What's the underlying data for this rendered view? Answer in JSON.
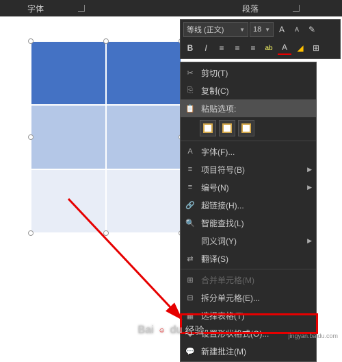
{
  "ribbon": {
    "font_section": "字体",
    "para_section": "段落"
  },
  "toolbar": {
    "font_name": "等线 (正文)",
    "font_size": "18",
    "bold": "B",
    "italic": "I"
  },
  "menu": {
    "cut": "剪切(T)",
    "copy": "复制(C)",
    "paste_options": "粘贴选项:",
    "font": "字体(F)...",
    "bullets": "项目符号(B)",
    "numbering": "编号(N)",
    "hyperlink": "超链接(H)...",
    "smart_lookup": "智能查找(L)",
    "synonyms": "同义词(Y)",
    "translate": "翻译(S)",
    "merge": "合并单元格(M)",
    "split": "拆分单元格(E)...",
    "select_table": "选择表格(T)",
    "format_shape": "设置形状格式(O)...",
    "new_comment": "新建批注(M)"
  },
  "watermark": {
    "brand": "Bai",
    "brand2": "du",
    "sub": "经验",
    "url": "jingyan.baidu.com"
  }
}
